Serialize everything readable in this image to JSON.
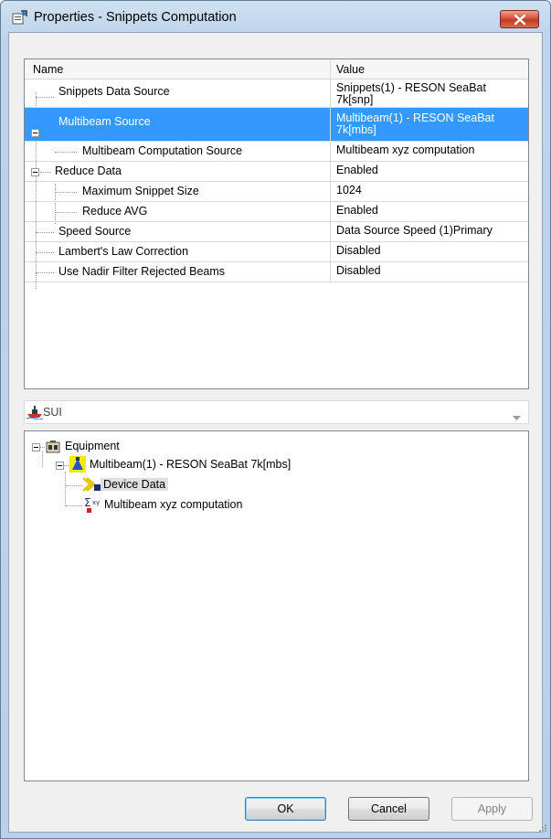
{
  "window": {
    "title": "Properties - Snippets Computation"
  },
  "grid": {
    "header": {
      "name": "Name",
      "value": "Value"
    },
    "rows": [
      {
        "name": "Snippets Data Source",
        "value": "Snippets(1) - RESON SeaBat 7k[snp]"
      },
      {
        "name": "Multibeam Source",
        "value": "Multibeam(1) - RESON SeaBat 7k[mbs]",
        "selected": true
      },
      {
        "name": "Multibeam Computation Source",
        "value": "Multibeam xyz computation"
      },
      {
        "name": "Reduce Data",
        "value": "Enabled"
      },
      {
        "name": "Maximum Snippet Size",
        "value": "1024"
      },
      {
        "name": "Reduce AVG",
        "value": "Enabled"
      },
      {
        "name": "Speed Source",
        "value": "Data Source Speed (1)Primary"
      },
      {
        "name": "Lambert's Law Correction",
        "value": "Disabled"
      },
      {
        "name": "Use Nadir Filter Rejected Beams",
        "value": "Disabled"
      }
    ]
  },
  "combo": {
    "selected": "SUI",
    "icon": "vessel-icon"
  },
  "tree": {
    "root": {
      "label": "Equipment",
      "icon": "equipment-icon"
    },
    "device": {
      "label": "Multibeam(1) - RESON SeaBat 7k[mbs]",
      "icon": "multibeam-icon"
    },
    "children": [
      {
        "label": "Device Data",
        "icon": "device-data-icon",
        "selected": true
      },
      {
        "label": "Multibeam xyz computation",
        "icon": "computation-icon"
      }
    ]
  },
  "buttons": {
    "ok": "OK",
    "cancel": "Cancel",
    "apply": "Apply"
  },
  "colors": {
    "selection": "#3399ff",
    "close_button": "#c23a22",
    "frame": "#bfd4ea"
  }
}
